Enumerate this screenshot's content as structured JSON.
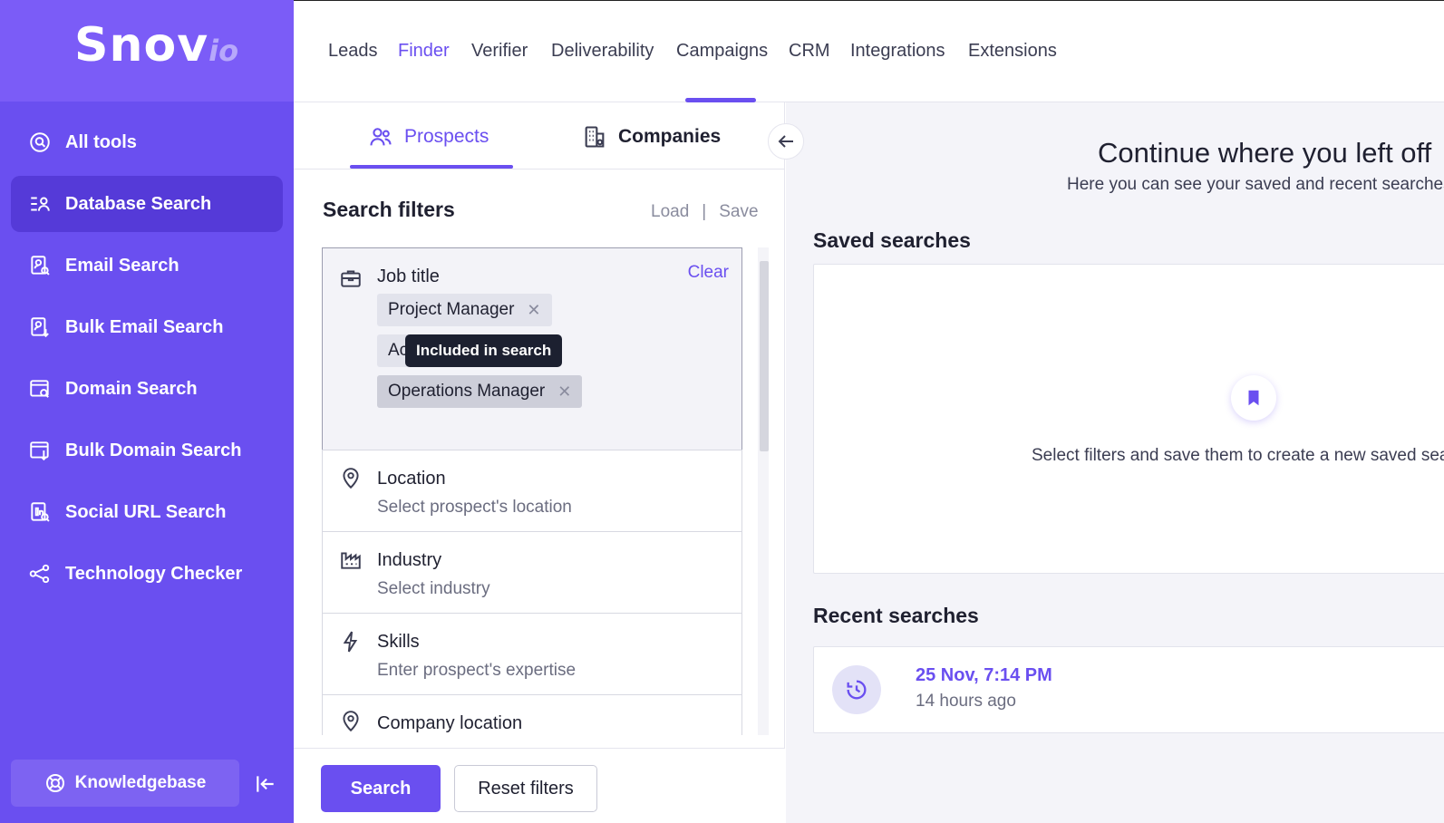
{
  "logo": {
    "main": "Snov",
    "suffix": "io"
  },
  "sidebar": {
    "items": [
      {
        "label": "All tools",
        "icon": "search-circle-icon"
      },
      {
        "label": "Database Search",
        "icon": "list-user-icon"
      },
      {
        "label": "Email Search",
        "icon": "doc-search-icon"
      },
      {
        "label": "Bulk Email Search",
        "icon": "doc-download-icon"
      },
      {
        "label": "Domain Search",
        "icon": "window-search-icon"
      },
      {
        "label": "Bulk Domain Search",
        "icon": "window-download-icon"
      },
      {
        "label": "Social URL Search",
        "icon": "social-search-icon"
      },
      {
        "label": "Technology Checker",
        "icon": "share-nodes-icon"
      }
    ],
    "active_index": 1,
    "knowledgebase_label": "Knowledgebase"
  },
  "topnav": {
    "items": [
      "Leads",
      "Finder",
      "Verifier",
      "Deliverability",
      "Campaigns",
      "CRM",
      "Integrations",
      "Extensions"
    ],
    "active": "Finder"
  },
  "subtabs": {
    "prospects": "Prospects",
    "companies": "Companies"
  },
  "filters": {
    "title": "Search filters",
    "load": "Load",
    "separator": "|",
    "save": "Save",
    "job_title": {
      "label": "Job title",
      "clear": "Clear",
      "chips": [
        "Project Manager",
        "Ac",
        "Operations Manager"
      ],
      "chip_remove": "✕",
      "tooltip": "Included in search"
    },
    "location": {
      "label": "Location",
      "placeholder": "Select prospect's location"
    },
    "industry": {
      "label": "Industry",
      "placeholder": "Select industry"
    },
    "skills": {
      "label": "Skills",
      "placeholder": "Enter prospect's expertise"
    },
    "company_location": {
      "label": "Company location"
    }
  },
  "actions": {
    "search": "Search",
    "reset": "Reset filters"
  },
  "right_panel": {
    "title": "Continue where you left off",
    "subtitle": "Here you can see your saved and recent searches",
    "saved_title": "Saved searches",
    "saved_empty": "Select filters and save them to create a new saved search",
    "recent_title": "Recent searches",
    "recent": [
      {
        "date": "25 Nov, 7:14 PM",
        "ago": "14 hours ago"
      }
    ]
  },
  "colors": {
    "accent": "#6a4ff0",
    "sidebar": "#6a4ff0",
    "logo_bg": "#7b5cf7"
  }
}
